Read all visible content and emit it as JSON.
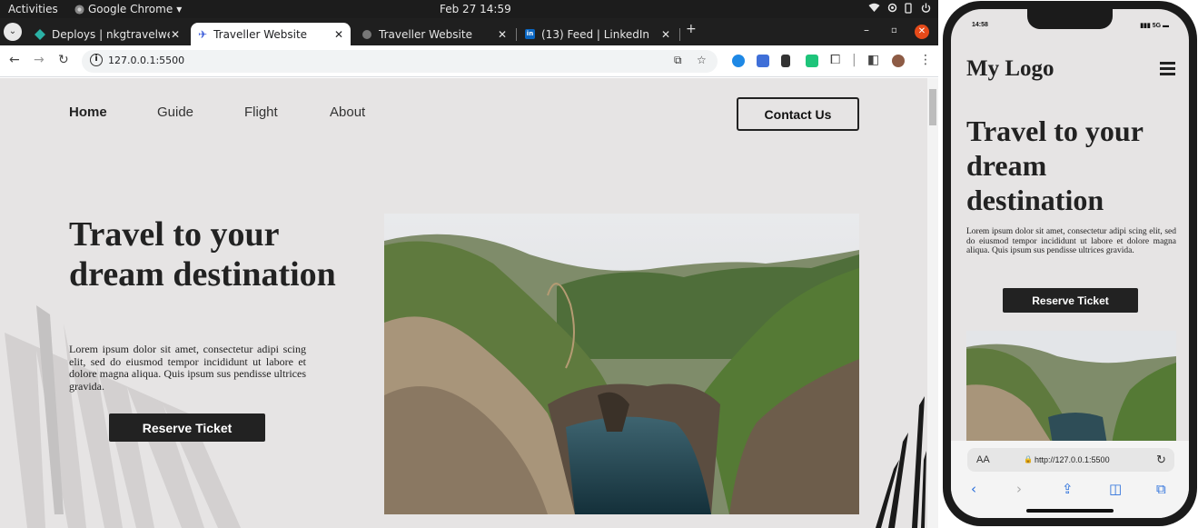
{
  "os_bar": {
    "activities": "Activities",
    "app_name": "Google Chrome",
    "datetime": "Feb 27  14:59"
  },
  "browser": {
    "tabs": [
      {
        "title": "Deploys | nkgtravelwebsi",
        "active": false
      },
      {
        "title": "Traveller Website",
        "active": true
      },
      {
        "title": "Traveller Website",
        "active": false
      },
      {
        "title": "(13) Feed | LinkedIn",
        "active": false
      }
    ],
    "new_tab": "+",
    "url": "127.0.0.1:5500"
  },
  "site": {
    "nav": {
      "links": [
        "Home",
        "Guide",
        "Flight",
        "About"
      ],
      "contact_label": "Contact Us"
    },
    "hero": {
      "title": "Travel to your dream destination",
      "text": "Lorem ipsum dolor sit amet, consectetur adipi scing elit, sed do eiusmod tempor incididunt ut labore et dolore magna aliqua. Quis ipsum sus pendisse ultrices gravida.",
      "button_label": "Reserve Ticket"
    }
  },
  "phone": {
    "time": "14:58",
    "network": "5G",
    "logo": "My Logo",
    "hero_title": "Travel to your dream destination",
    "hero_text": "Lorem ipsum dolor sit amet, consectetur adipi scing elit, sed do eiusmod tempor incididunt ut labore et dolore magna aliqua. Quis ipsum sus pendisse ultrices gravida.",
    "button_label": "Reserve Ticket",
    "aa_label": "AA",
    "url": "http://127.0.0.1:5500"
  },
  "colors": {
    "page_bg": "#e6e4e4",
    "dark": "#222222",
    "tab_strip": "#1f1f1f"
  }
}
